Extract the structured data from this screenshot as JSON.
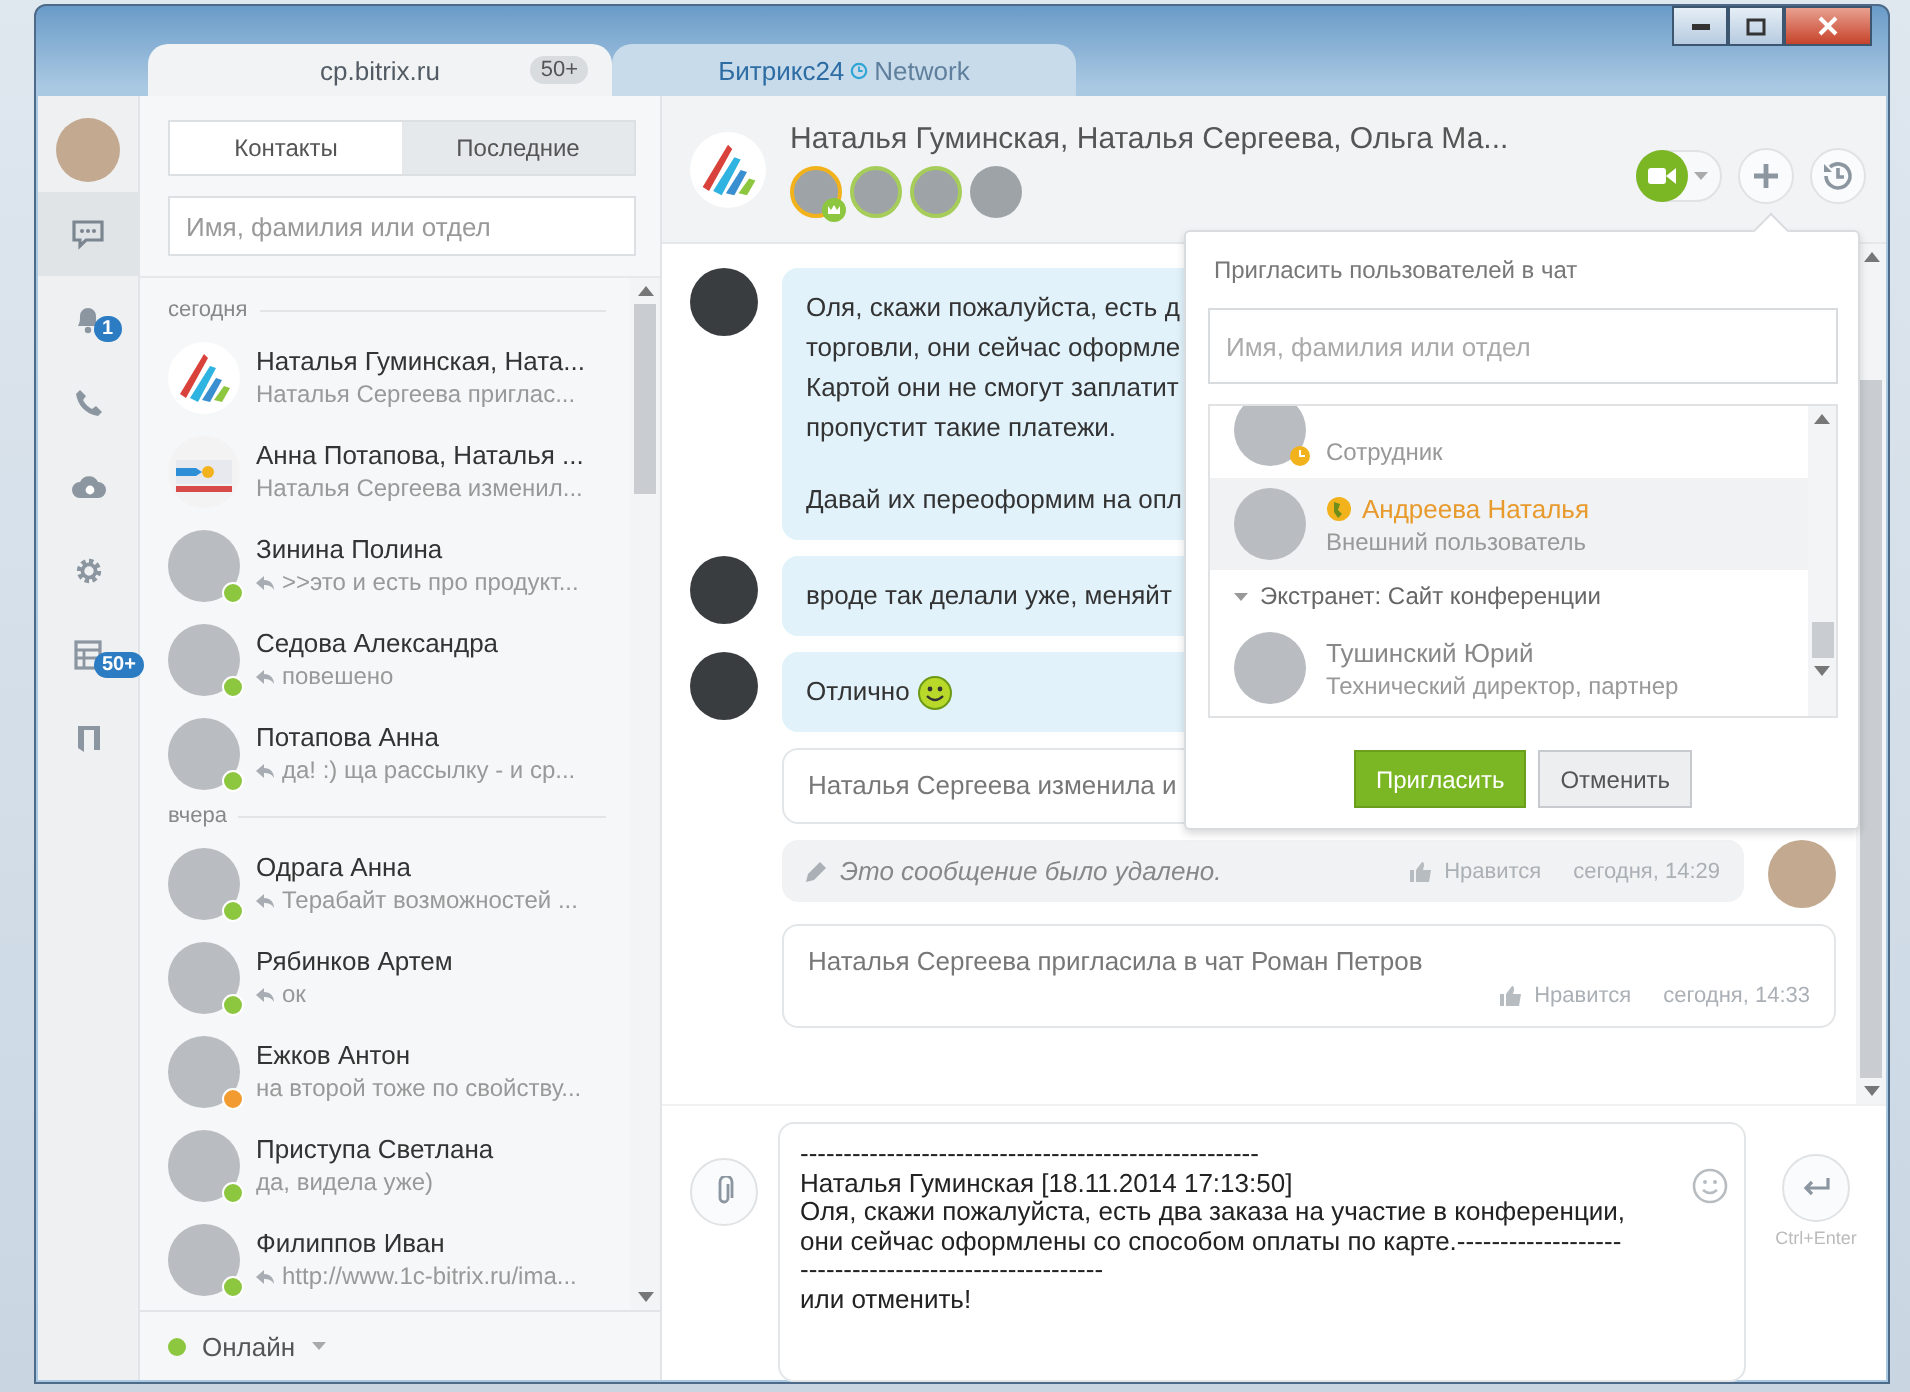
{
  "window_tabs": [
    {
      "label": "cp.bitrix.ru",
      "badge": "50+",
      "selected": true
    },
    {
      "label": "Битрикс24",
      "label2": "Network",
      "selected": false
    }
  ],
  "rail": [
    {
      "kind": "avatar",
      "selected": false
    },
    {
      "kind": "chat",
      "selected": true
    },
    {
      "kind": "bell",
      "badge": "1",
      "selected": false
    },
    {
      "kind": "phone",
      "selected": false
    },
    {
      "kind": "cloud",
      "selected": false
    },
    {
      "kind": "gear",
      "selected": false
    },
    {
      "kind": "grid",
      "badge": "50+",
      "selected": false
    },
    {
      "kind": "book",
      "selected": false
    }
  ],
  "contacts": {
    "tabs": [
      {
        "label": "Контакты",
        "selected": true
      },
      {
        "label": "Последние",
        "selected": false
      }
    ],
    "search": {
      "placeholder": "Имя, фамилия или отдел"
    },
    "groups": [
      {
        "title": "сегодня",
        "items": [
          {
            "name": "Наталья Гуминская, Ната...",
            "preview": "Наталья Сергеева приглас...",
            "kind": "group",
            "replied": false
          },
          {
            "name": "Анна Потапова, Наталья ...",
            "preview": "Наталья Сергеева изменил...",
            "kind": "group2",
            "replied": false
          },
          {
            "name": "Зинина Полина",
            "preview": ">>это и есть про продукт...",
            "kind": "person",
            "replied": true,
            "online": true
          },
          {
            "name": "Седова Александра",
            "preview": "повешено",
            "kind": "person",
            "replied": true,
            "online": true
          },
          {
            "name": "Потапова Анна",
            "preview": "да! :) ща рассылку - и ср...",
            "kind": "person",
            "replied": true,
            "online": true
          }
        ]
      },
      {
        "title": "вчера",
        "items": [
          {
            "name": "Одрага Анна",
            "preview": "Терабайт возможностей ...",
            "kind": "person",
            "replied": true,
            "online": true
          },
          {
            "name": "Рябинков Артем",
            "preview": "ок",
            "kind": "person",
            "replied": true,
            "online": true
          },
          {
            "name": "Ежков Антон",
            "preview": "на второй тоже по свойству...",
            "kind": "person",
            "replied": false,
            "away": true
          },
          {
            "name": "Приступа Светлана",
            "preview": "да, видела уже)",
            "kind": "person",
            "replied": false,
            "online": true
          },
          {
            "name": "Филиппов Иван",
            "preview": "http://www.1c-bitrix.ru/ima...",
            "kind": "person",
            "replied": true,
            "online": true
          }
        ]
      }
    ],
    "status": {
      "label": "Онлайн",
      "color": "#8dc63f"
    }
  },
  "chat": {
    "title": "Наталья Гуминская, Наталья Сергеева, Ольга Ма...",
    "members": [
      {
        "owner": true,
        "online": true
      },
      {
        "owner": false,
        "online": true
      },
      {
        "owner": false,
        "online": true
      },
      {
        "owner": false,
        "online": false
      }
    ],
    "messages": [
      {
        "kind": "bubble",
        "paragraphs": [
          [
            "Оля, скажи пожалуйста, есть д",
            "торговли, они сейчас оформле",
            "Картой они не смогут заплатит",
            "пропустит такие платежи."
          ],
          [
            "Давай их переоформим на опл"
          ]
        ]
      },
      {
        "kind": "bubble",
        "paragraphs": [
          [
            "вроде так делали уже, меняйт"
          ]
        ]
      },
      {
        "kind": "bubble",
        "paragraphs": [
          [
            "Отлично"
          ]
        ],
        "smiley": true
      },
      {
        "kind": "system",
        "text": "Наталья Сергеева изменила и"
      },
      {
        "kind": "deleted",
        "text": "Это сообщение было удалено.",
        "like": "Нравится",
        "time": "сегодня, 14:29"
      },
      {
        "kind": "system",
        "text": "Наталья Сергеева пригласила в чат Роман Петров",
        "like": "Нравится",
        "time": "сегодня, 14:33"
      }
    ],
    "compose": {
      "value": "-----------------------------------------------------\nНаталья Гуминская [18.11.2014 17:13:50]\nОля, скажи пожалуйста, есть два заказа на участие в конференции,\nони сейчас оформлены со способом оплаты по карте.-------------------\n-----------------------------------\nили отменить!",
      "send_hint": "Ctrl+Enter"
    }
  },
  "invite": {
    "title": "Пригласить пользователей в чат",
    "search": {
      "placeholder": "Имя, фамилия или отдел"
    },
    "items": [
      {
        "kind": "user",
        "role": "Сотрудник",
        "away": true,
        "selected": false
      },
      {
        "kind": "user",
        "name": "Андреева Наталья",
        "role": "Внешний пользователь",
        "extranet": true,
        "selected": true
      },
      {
        "kind": "header",
        "name": "Экстранет: Сайт конференции",
        "expanded": true
      },
      {
        "kind": "user",
        "name": "Тушинский Юрий",
        "role": "Технический директор, партнер",
        "selected": false
      }
    ],
    "buttons": [
      {
        "label": "Пригласить",
        "kind": "primary"
      },
      {
        "label": "Отменить",
        "kind": "secondary"
      }
    ]
  }
}
